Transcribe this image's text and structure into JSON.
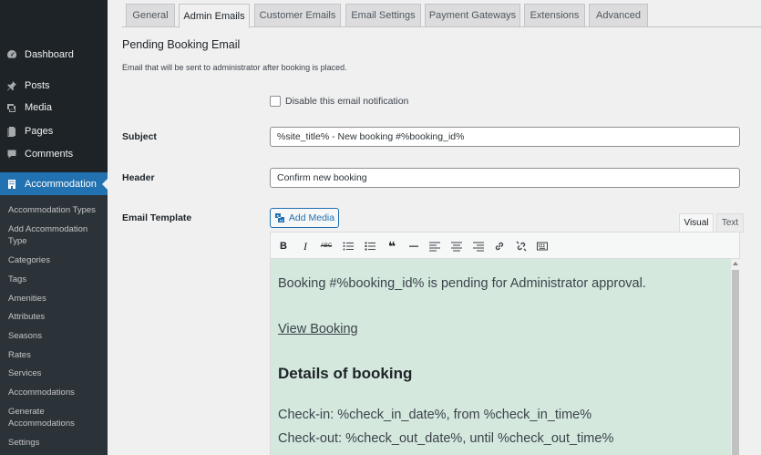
{
  "sidebar": {
    "items": [
      {
        "label": "Dashboard",
        "icon": "dashboard-icon"
      },
      {
        "label": "Posts",
        "icon": "pin-icon"
      },
      {
        "label": "Media",
        "icon": "media-icon"
      },
      {
        "label": "Pages",
        "icon": "pages-icon"
      },
      {
        "label": "Comments",
        "icon": "comments-icon"
      },
      {
        "label": "Accommodation",
        "icon": "building-icon",
        "active": true
      }
    ],
    "submenu": [
      "Accommodation Types",
      "Add Accommodation Type",
      "Categories",
      "Tags",
      "Amenities",
      "Attributes",
      "Seasons",
      "Rates",
      "Services",
      "Accommodations",
      "Generate Accommodations",
      "Settings"
    ]
  },
  "tabs": [
    {
      "label": "General"
    },
    {
      "label": "Admin Emails",
      "active": true
    },
    {
      "label": "Customer Emails"
    },
    {
      "label": "Email Settings"
    },
    {
      "label": "Payment Gateways"
    },
    {
      "label": "Extensions"
    },
    {
      "label": "Advanced"
    }
  ],
  "section": {
    "title": "Pending Booking Email",
    "description": "Email that will be sent to administrator after booking is placed."
  },
  "disable_checkbox": {
    "label": "Disable this email notification",
    "checked": false
  },
  "fields": {
    "subject_label": "Subject",
    "subject_value": "%site_title% - New booking #%booking_id%",
    "header_label": "Header",
    "header_value": "Confirm new booking",
    "template_label": "Email Template"
  },
  "editor": {
    "add_media_label": "Add Media",
    "tab_visual": "Visual",
    "tab_text": "Text",
    "toolbar": [
      "bold",
      "italic",
      "strikethrough",
      "bulleted-list",
      "numbered-list",
      "blockquote",
      "horizontal-line",
      "align-left",
      "align-center",
      "align-right",
      "insert-link",
      "remove-link",
      "toolbar-toggle"
    ],
    "bold_glyph": "B",
    "italic_glyph": "I",
    "strike_glyph": "ABC",
    "quote_glyph": "❝",
    "content": {
      "line1": "Booking #%booking_id% is pending for Administrator approval.",
      "link": "View Booking",
      "heading": "Details of booking",
      "checkin": "Check-in: %check_in_date%, from %check_in_time%",
      "checkout": "Check-out: %check_out_date%, until %check_out_time%"
    },
    "content_bg": "#d4e8de"
  },
  "colors": {
    "sidebar_bg": "#1d2327",
    "accent": "#2271b1"
  }
}
